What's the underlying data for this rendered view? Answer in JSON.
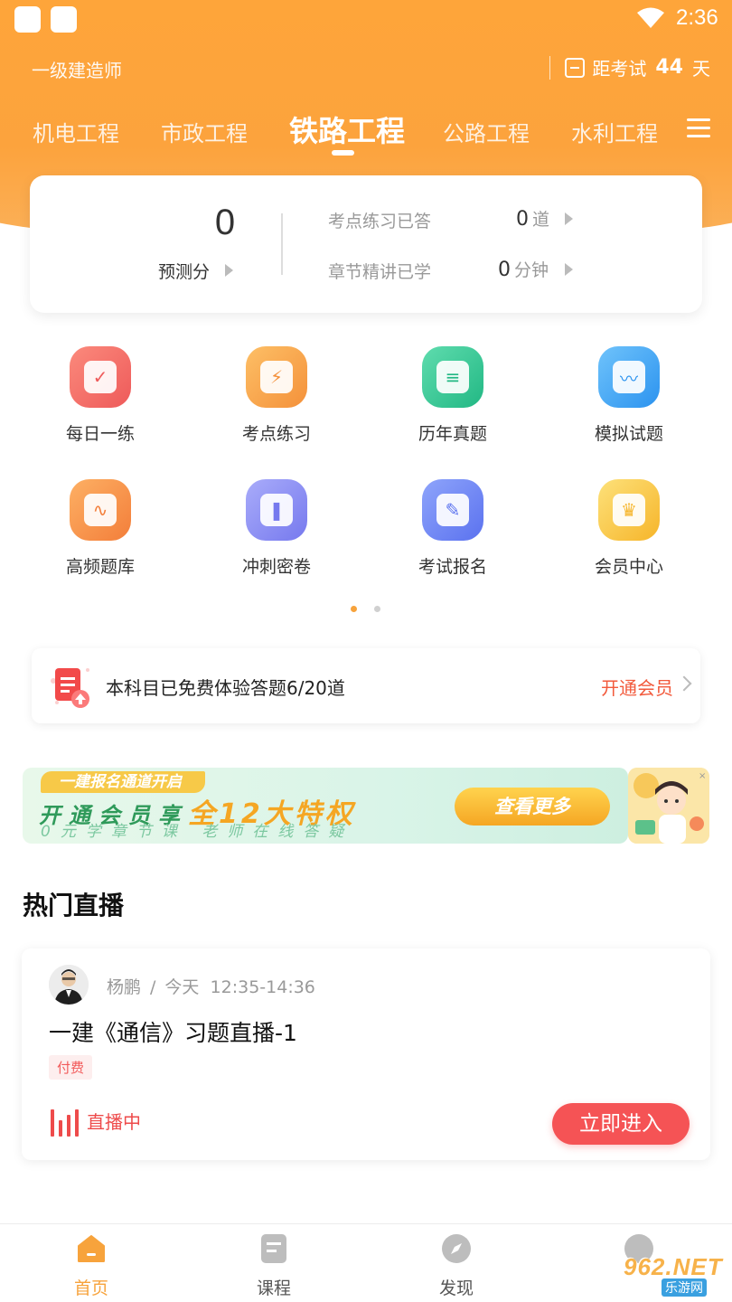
{
  "status_bar": {
    "time": "2:36"
  },
  "header": {
    "exam_name": "一级建造师",
    "countdown_prefix": "距考试",
    "countdown_days": "44",
    "countdown_suffix": "天"
  },
  "tabs": [
    {
      "label": "机电工程",
      "active": false
    },
    {
      "label": "市政工程",
      "active": false
    },
    {
      "label": "铁路工程",
      "active": true
    },
    {
      "label": "公路工程",
      "active": false
    },
    {
      "label": "水利工程",
      "active": false
    }
  ],
  "stats": {
    "score_value": "0",
    "score_label": "预测分",
    "rows": [
      {
        "label": "考点练习已答",
        "value": "0",
        "unit": "道"
      },
      {
        "label": "章节精讲已学",
        "value": "0",
        "unit": "分钟"
      }
    ]
  },
  "grid": [
    {
      "label": "每日一练",
      "icon": "calendar-check-icon",
      "color": "#f26d6d"
    },
    {
      "label": "考点练习",
      "icon": "lightning-card-icon",
      "color": "#f7a64a"
    },
    {
      "label": "历年真题",
      "icon": "document-leaf-icon",
      "color": "#35c596"
    },
    {
      "label": "模拟试题",
      "icon": "monitor-chart-icon",
      "color": "#3ba6f3"
    },
    {
      "label": "高频题库",
      "icon": "scroll-pulse-icon",
      "color": "#f79546"
    },
    {
      "label": "冲刺密卷",
      "icon": "bookmark-book-icon",
      "color": "#8b8df3"
    },
    {
      "label": "考试报名",
      "icon": "pen-signup-icon",
      "color": "#6f86f2"
    },
    {
      "label": "会员中心",
      "icon": "crown-icon",
      "color": "#f7c23a"
    }
  ],
  "pager": {
    "active_color": "#f7a33c",
    "inactive_color": "#d0d0d0"
  },
  "trial": {
    "text": "本科目已免费体验答题6/20道",
    "action": "开通会员"
  },
  "banner": {
    "tag": "一建报名通道开启",
    "main_prefix": "开通会员享",
    "main_highlight": "全12大特权",
    "sub": "0元学章节课 老师在线答疑",
    "button": "查看更多"
  },
  "live_section": {
    "title": "热门直播",
    "card": {
      "teacher": "杨鹏",
      "day": "今天",
      "time": "12:35-14:36",
      "title": "一建《通信》习题直播-1",
      "badge": "付费",
      "status": "直播中",
      "button": "立即进入"
    }
  },
  "bottom_nav": [
    {
      "label": "首页",
      "icon": "home-icon",
      "active": true
    },
    {
      "label": "课程",
      "icon": "course-icon",
      "active": false
    },
    {
      "label": "发现",
      "icon": "compass-icon",
      "active": false
    }
  ],
  "watermark": {
    "text": "962.NET",
    "sub": "乐游网"
  },
  "colors": {
    "accent": "#fca33d",
    "live_red": "#f55355",
    "action_orange": "#f25a3c"
  }
}
